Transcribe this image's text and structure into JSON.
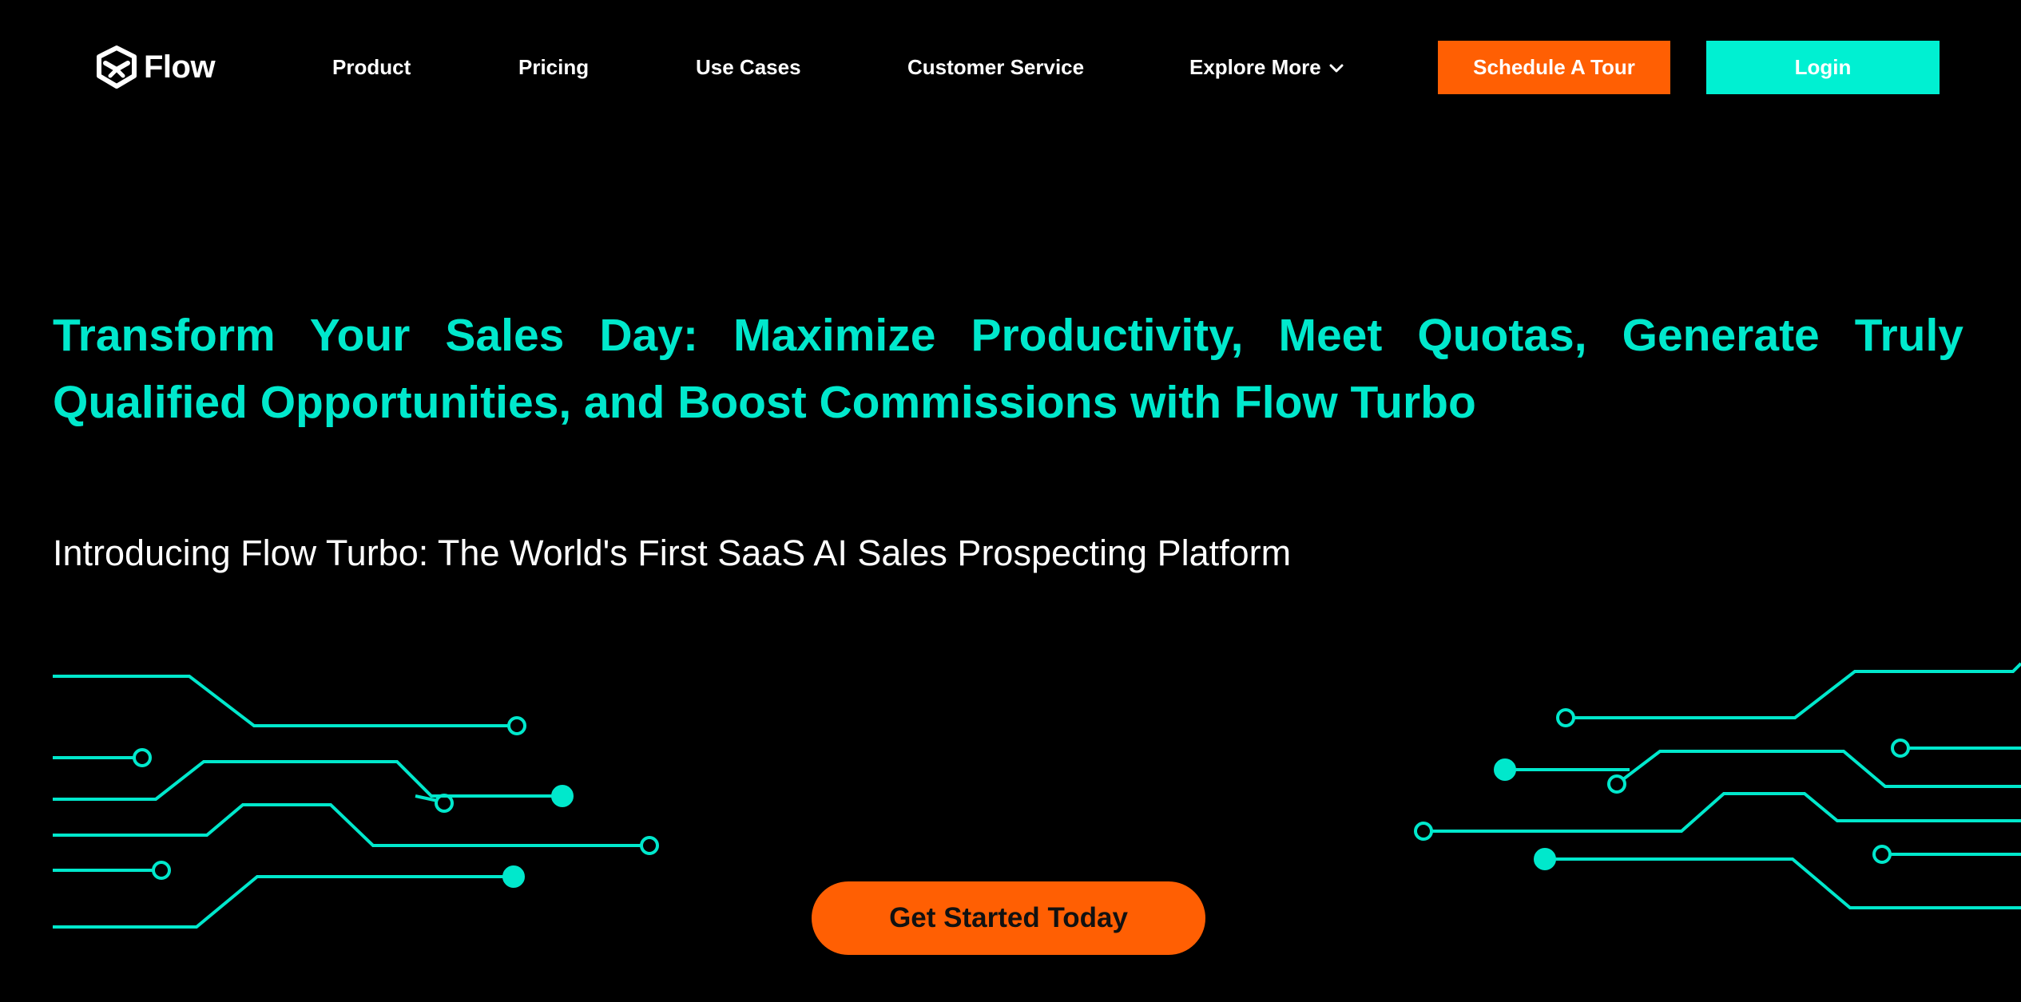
{
  "header": {
    "logo_text": "Flow",
    "nav": [
      {
        "label": "Product"
      },
      {
        "label": "Pricing"
      },
      {
        "label": "Use Cases"
      },
      {
        "label": "Customer Service"
      },
      {
        "label": "Explore More"
      }
    ],
    "schedule_label": "Schedule A Tour",
    "login_label": "Login"
  },
  "hero": {
    "headline": "Transform Your Sales Day: Maximize Productivity, Meet Quotas, Generate Truly Qualified Opportunities, and Boost Commissions with Flow Turbo",
    "subheadline": "Introducing Flow Turbo: The World's First SaaS AI Sales Prospecting Platform",
    "cta_label": "Get Started Today"
  },
  "colors": {
    "background": "#000000",
    "accent_teal": "#00e8cc",
    "accent_orange": "#ff5f03"
  },
  "icons": {
    "logo": "flow-logo-icon",
    "explore_more": "chevron-down-icon",
    "decoration": "circuit-lines-icon"
  }
}
